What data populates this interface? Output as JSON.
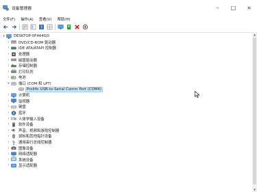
{
  "window": {
    "title": "设备管理器",
    "minimize": "–",
    "maximize": "□",
    "close": "×"
  },
  "menu": [
    "文件(F)",
    "操作(A)",
    "查看(V)",
    "帮助(H)"
  ],
  "toolbar": {
    "icons": [
      "back-arrow-icon",
      "forward-arrow-icon",
      "properties-icon",
      "show-hide-icon",
      "help-icon",
      "monitor-icon",
      "update-driver-icon",
      "uninstall-icon",
      "scan-icon"
    ],
    "colors": {
      "uninstall": "#d4201b",
      "enable": "#2d9b3c",
      "help": "#3a6fc4"
    }
  },
  "tree": {
    "root": "DESKTOP-0F444GO",
    "items": [
      {
        "label": "DVD/CD-ROM 驱动器",
        "icon": "dvd-drive-icon"
      },
      {
        "label": "IDE ATA/ATAPI 控制器",
        "icon": "ide-controller-icon"
      },
      {
        "label": "处理器",
        "icon": "processor-icon"
      },
      {
        "label": "磁盘驱动器",
        "icon": "disk-drive-icon"
      },
      {
        "label": "存储控制器",
        "icon": "storage-controller-icon"
      },
      {
        "label": "打印队列",
        "icon": "printer-icon"
      },
      {
        "label": "电池",
        "icon": "battery-icon"
      },
      {
        "label": "端口 (COM 和 LPT)",
        "icon": "port-icon",
        "expanded": true,
        "children": [
          {
            "label": "Prolific USB-to-Serial Comm Port (COM4)",
            "icon": "serial-port-icon",
            "selected": true
          }
        ]
      },
      {
        "label": "计算机",
        "icon": "computer-icon"
      },
      {
        "label": "监视器",
        "icon": "monitor-icon"
      },
      {
        "label": "键盘",
        "icon": "keyboard-icon"
      },
      {
        "label": "蓝牙",
        "icon": "bluetooth-icon"
      },
      {
        "label": "人体学输入设备",
        "icon": "hid-icon"
      },
      {
        "label": "软件设备",
        "icon": "software-device-icon"
      },
      {
        "label": "声音、视频和游戏控制器",
        "icon": "sound-icon"
      },
      {
        "label": "鼠标和其他指针设备",
        "icon": "mouse-icon"
      },
      {
        "label": "通用串行总线控制器",
        "icon": "usb-icon"
      },
      {
        "label": "图像设备",
        "icon": "camera-icon"
      },
      {
        "label": "网络适配器",
        "icon": "network-icon"
      },
      {
        "label": "系统设备",
        "icon": "system-device-icon"
      },
      {
        "label": "显示适配器",
        "icon": "display-adapter-icon"
      }
    ]
  }
}
